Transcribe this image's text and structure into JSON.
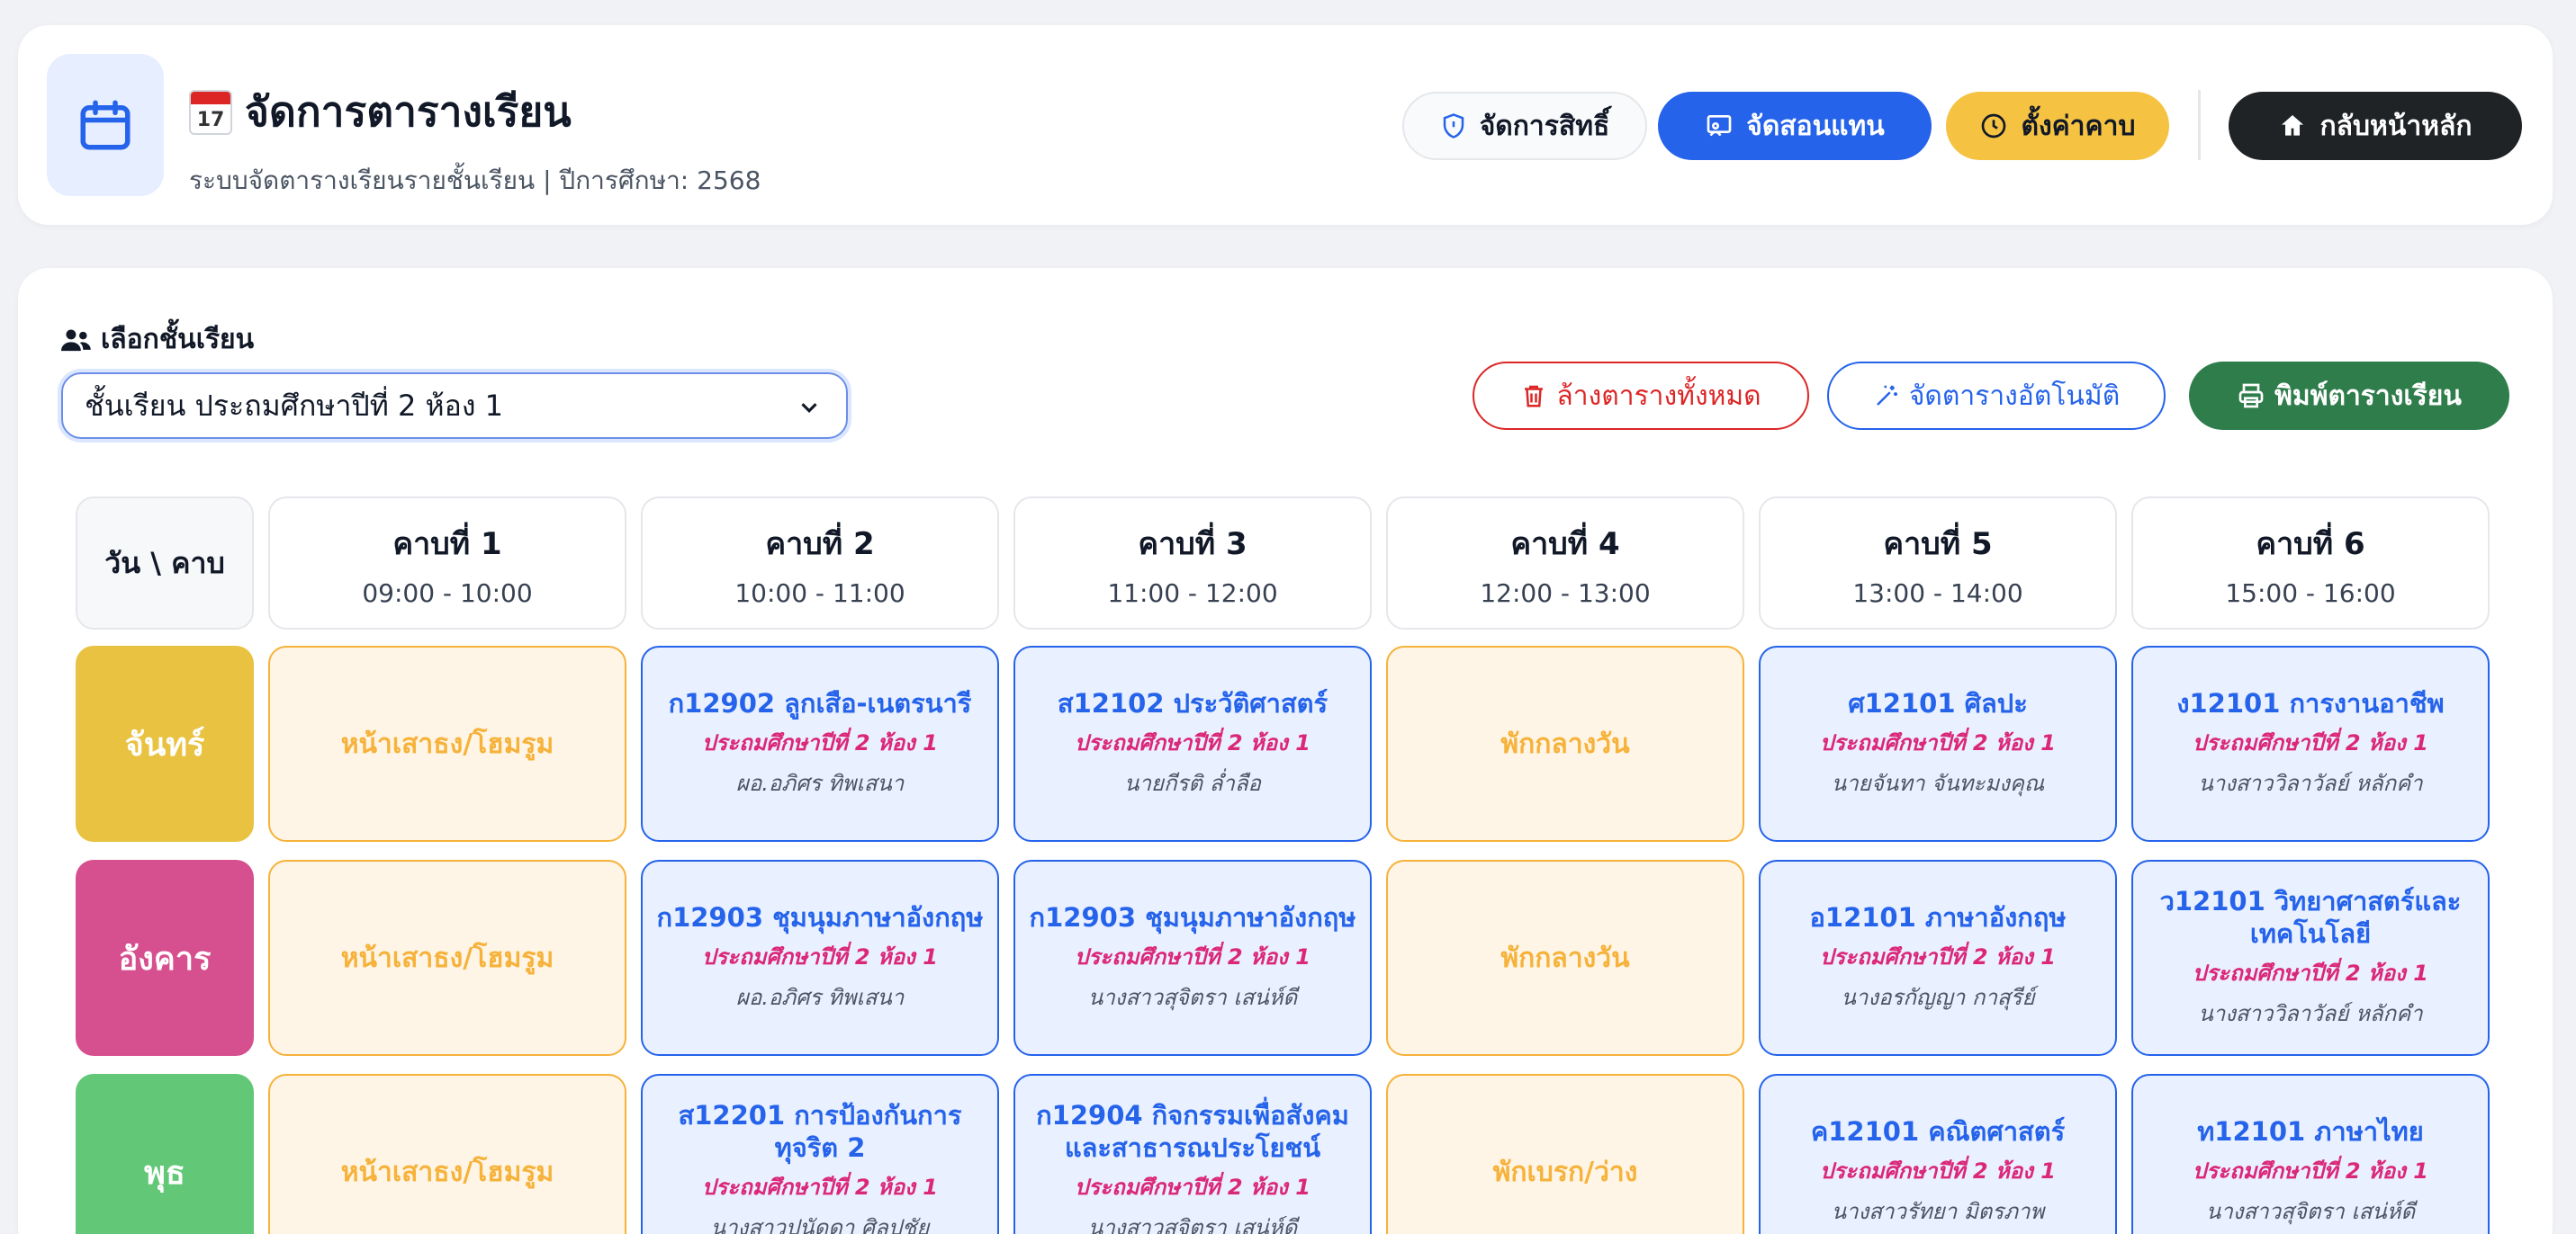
{
  "header": {
    "title": "จัดการตารางเรียน",
    "calendar_day": "17",
    "subtitle": "ระบบจัดตารางเรียนรายชั้นเรียน | ปีการศึกษา: 2568",
    "buttons": {
      "permissions": "จัดการสิทธิ์",
      "substitute": "จัดสอนแทน",
      "periods": "ตั้งค่าคาบ",
      "home": "กลับหน้าหลัก"
    }
  },
  "class_selector": {
    "label": "เลือกชั้นเรียน",
    "value": "ชั้นเรียน ประถมศึกษาปีที่ 2 ห้อง 1"
  },
  "actions": {
    "clear": "ล้างตารางทั้งหมด",
    "auto": "จัดตารางอัตโนมัติ",
    "print": "พิมพ์ตารางเรียน"
  },
  "colors": {
    "accent": "#2563eb",
    "warning": "#f6b23a",
    "danger": "#dc2626",
    "success": "#2f7d4b"
  },
  "timetable": {
    "corner": "วัน \\ คาบ",
    "periods": [
      {
        "name": "คาบที่ 1",
        "time": "09:00 - 10:00"
      },
      {
        "name": "คาบที่ 2",
        "time": "10:00 - 11:00"
      },
      {
        "name": "คาบที่ 3",
        "time": "11:00 - 12:00"
      },
      {
        "name": "คาบที่ 4",
        "time": "12:00 - 13:00"
      },
      {
        "name": "คาบที่ 5",
        "time": "13:00 - 14:00"
      },
      {
        "name": "คาบที่ 6",
        "time": "15:00 - 16:00"
      }
    ],
    "days": [
      {
        "name": "จันทร์",
        "color": "#e8c240",
        "slots": [
          {
            "kind": "break",
            "label": "หน้าเสาธง/โฮมรูม"
          },
          {
            "kind": "subject",
            "subject": "ก12902 ลูกเสือ-เนตรนารี",
            "class": "ประถมศึกษาปีที่ 2 ห้อง 1",
            "teacher": "ผอ.อภิศร ทิพเสนา"
          },
          {
            "kind": "subject",
            "subject": "ส12102 ประวัติศาสตร์",
            "class": "ประถมศึกษาปีที่ 2 ห้อง 1",
            "teacher": "นายกีรติ ล่ำลือ"
          },
          {
            "kind": "break",
            "label": "พักกลางวัน"
          },
          {
            "kind": "subject",
            "subject": "ศ12101 ศิลปะ",
            "class": "ประถมศึกษาปีที่ 2 ห้อง 1",
            "teacher": "นายจันทา จันทะมงคุณ"
          },
          {
            "kind": "subject",
            "subject": "ง12101 การงานอาชีพ",
            "class": "ประถมศึกษาปีที่ 2 ห้อง 1",
            "teacher": "นางสาววิลาวัลย์ หลักคำ"
          }
        ]
      },
      {
        "name": "อังคาร",
        "color": "#d64f8e",
        "slots": [
          {
            "kind": "break",
            "label": "หน้าเสาธง/โฮมรูม"
          },
          {
            "kind": "subject",
            "subject": "ก12903 ชุมนุมภาษาอังกฤษ",
            "class": "ประถมศึกษาปีที่ 2 ห้อง 1",
            "teacher": "ผอ.อภิศร ทิพเสนา"
          },
          {
            "kind": "subject",
            "subject": "ก12903 ชุมนุมภาษาอังกฤษ",
            "class": "ประถมศึกษาปีที่ 2 ห้อง 1",
            "teacher": "นางสาวสุจิตรา เสน่ห์ดี"
          },
          {
            "kind": "break",
            "label": "พักกลางวัน"
          },
          {
            "kind": "subject",
            "subject": "อ12101 ภาษาอังกฤษ",
            "class": "ประถมศึกษาปีที่ 2 ห้อง 1",
            "teacher": "นางอรกัญญา กาสุรีย์"
          },
          {
            "kind": "subject",
            "subject": "ว12101 วิทยาศาสตร์และเทคโนโลยี",
            "class": "ประถมศึกษาปีที่ 2 ห้อง 1",
            "teacher": "นางสาววิลาวัลย์ หลักคำ"
          }
        ]
      },
      {
        "name": "พุธ",
        "color": "#62c877",
        "slots": [
          {
            "kind": "break",
            "label": "หน้าเสาธง/โฮมรูม"
          },
          {
            "kind": "subject",
            "subject": "ส12201 การป้องกันการทุจริต 2",
            "class": "ประถมศึกษาปีที่ 2 ห้อง 1",
            "teacher": "นางสาวปนัดดา ศิลปชัย"
          },
          {
            "kind": "subject",
            "subject": "ก12904 กิจกรรมเพื่อสังคมและสาธารณประโยชน์",
            "class": "ประถมศึกษาปีที่ 2 ห้อง 1",
            "teacher": "นางสาวสุจิตรา เสน่ห์ดี"
          },
          {
            "kind": "break",
            "label": "พักเบรก/ว่าง"
          },
          {
            "kind": "subject",
            "subject": "ค12101 คณิตศาสตร์",
            "class": "ประถมศึกษาปีที่ 2 ห้อง 1",
            "teacher": "นางสาวรัทยา มิตรภาพ"
          },
          {
            "kind": "subject",
            "subject": "ท12101 ภาษาไทย",
            "class": "ประถมศึกษาปีที่ 2 ห้อง 1",
            "teacher": "นางสาวสุจิตรา เสน่ห์ดี"
          }
        ]
      }
    ]
  }
}
